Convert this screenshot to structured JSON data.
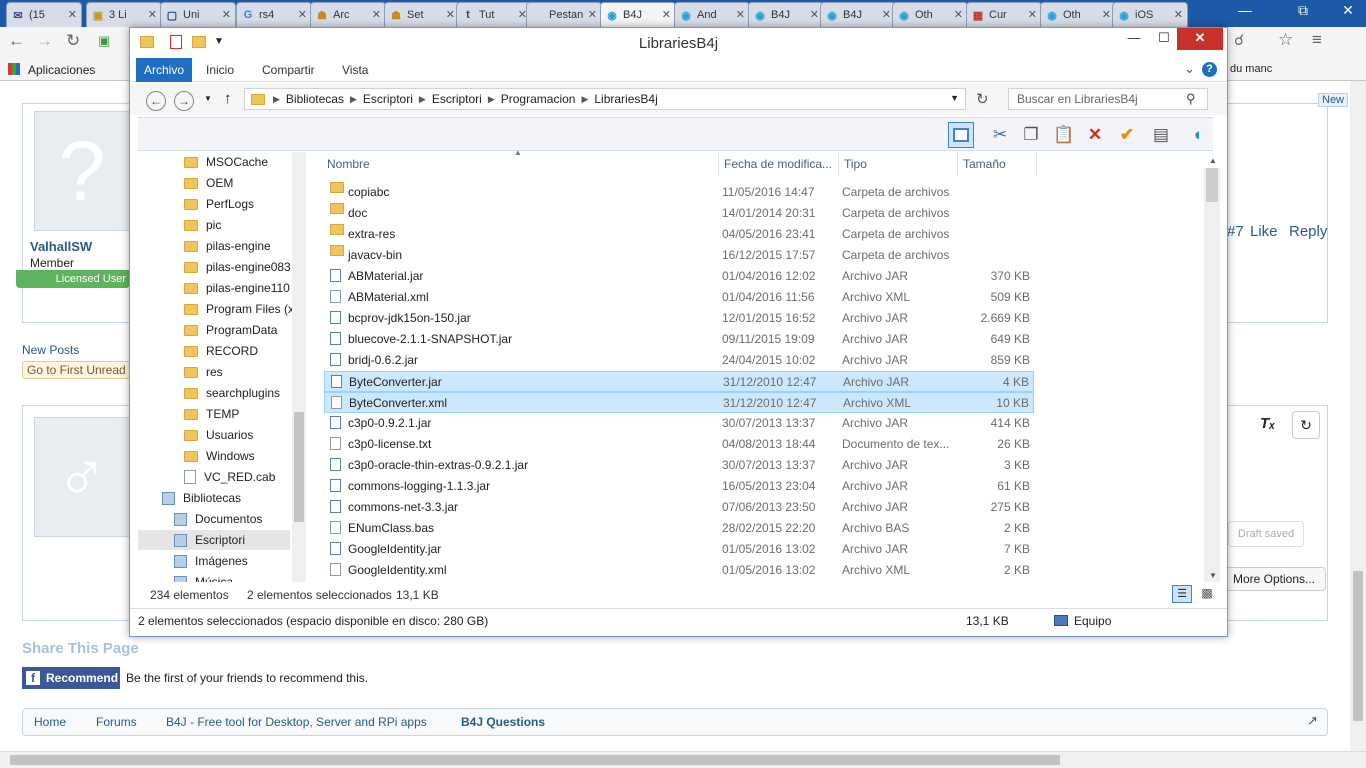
{
  "browser": {
    "tabs": [
      {
        "label": "(15",
        "icon": "mail-icon"
      },
      {
        "label": "3 Li",
        "icon": "shop-icon"
      },
      {
        "label": "Uni",
        "icon": "doc-icon"
      },
      {
        "label": "rs4",
        "icon": "google-icon"
      },
      {
        "label": "Arc",
        "icon": "forum-icon"
      },
      {
        "label": "Set",
        "icon": "forum-icon"
      },
      {
        "label": "Tut",
        "icon": "tumblr-icon"
      },
      {
        "label": "Pestan",
        "icon": "blank-icon"
      },
      {
        "label": "B4J",
        "icon": "b4x-icon",
        "active": true
      },
      {
        "label": "And",
        "icon": "b4x-icon"
      },
      {
        "label": "B4J",
        "icon": "b4x-icon"
      },
      {
        "label": "B4J",
        "icon": "b4x-icon"
      },
      {
        "label": "Oth",
        "icon": "b4x-icon"
      },
      {
        "label": "Cur",
        "icon": "gencat-icon"
      },
      {
        "label": "Oth",
        "icon": "b4x-icon"
      },
      {
        "label": "iOS",
        "icon": "b4x-icon"
      }
    ],
    "bookmarks_label": "Aplicaciones",
    "bookmark_right": "du manc"
  },
  "forum": {
    "user_name": "ValhallSW",
    "user_role": "Member",
    "licensed_label": "Licensed User",
    "new_posts": "New Posts",
    "go_first_unread": "Go to First Unread",
    "post_number": "#7",
    "like": "Like",
    "reply": "Reply",
    "new_badge": "New",
    "draft_saved": "Draft saved",
    "more_options": "More Options...",
    "share_title": "Share This Page",
    "recommend": "Recommend",
    "recommend_text": "Be the first of your friends to recommend this.",
    "breadcrumbs": [
      "Home",
      "Forums",
      "B4J - Free tool for Desktop, Server and RPi apps",
      "B4J Questions"
    ]
  },
  "explorer": {
    "title": "LibrariesB4j",
    "ribbon_tabs": [
      "Archivo",
      "Inicio",
      "Compartir",
      "Vista"
    ],
    "breadcrumb": [
      "Bibliotecas",
      "Escriptori",
      "Escriptori",
      "Programacion",
      "LibrariesB4j"
    ],
    "search_placeholder": "Buscar en LibrariesB4j",
    "columns": {
      "name": "Nombre",
      "date": "Fecha de modifica...",
      "type": "Tipo",
      "size": "Tamaño"
    },
    "nav_items": [
      {
        "label": "MSOCache",
        "kind": "folder"
      },
      {
        "label": "OEM",
        "kind": "folder"
      },
      {
        "label": "PerfLogs",
        "kind": "folder"
      },
      {
        "label": "pic",
        "kind": "folder"
      },
      {
        "label": "pilas-engine",
        "kind": "folder"
      },
      {
        "label": "pilas-engine083",
        "kind": "folder"
      },
      {
        "label": "pilas-engine110",
        "kind": "folder"
      },
      {
        "label": "Program Files (x",
        "kind": "folder"
      },
      {
        "label": "ProgramData",
        "kind": "folder"
      },
      {
        "label": "RECORD",
        "kind": "folder"
      },
      {
        "label": "res",
        "kind": "folder"
      },
      {
        "label": "searchplugins",
        "kind": "folder"
      },
      {
        "label": "TEMP",
        "kind": "folder"
      },
      {
        "label": "Usuarios",
        "kind": "folder"
      },
      {
        "label": "Windows",
        "kind": "folder"
      },
      {
        "label": "VC_RED.cab",
        "kind": "file"
      },
      {
        "label": "Bibliotecas",
        "kind": "library"
      },
      {
        "label": "Documentos",
        "kind": "library"
      },
      {
        "label": "Escriptori",
        "kind": "library"
      },
      {
        "label": "Imágenes",
        "kind": "library"
      },
      {
        "label": "Música",
        "kind": "library"
      }
    ],
    "files": [
      {
        "name": "copiabc",
        "date": "11/05/2016 14:47",
        "type": "Carpeta de archivos",
        "size": "",
        "kind": "folder"
      },
      {
        "name": "doc",
        "date": "14/01/2014 20:31",
        "type": "Carpeta de archivos",
        "size": "",
        "kind": "folder"
      },
      {
        "name": "extra-res",
        "date": "04/05/2016 23:41",
        "type": "Carpeta de archivos",
        "size": "",
        "kind": "folder"
      },
      {
        "name": "javacv-bin",
        "date": "16/12/2015 17:57",
        "type": "Carpeta de archivos",
        "size": "",
        "kind": "folder"
      },
      {
        "name": "ABMaterial.jar",
        "date": "01/04/2016 12:02",
        "type": "Archivo JAR",
        "size": "370 KB",
        "kind": "jar"
      },
      {
        "name": "ABMaterial.xml",
        "date": "01/04/2016 11:56",
        "type": "Archivo XML",
        "size": "509 KB",
        "kind": "xml"
      },
      {
        "name": "bcprov-jdk15on-150.jar",
        "date": "12/01/2015 16:52",
        "type": "Archivo JAR",
        "size": "2.669 KB",
        "kind": "jar"
      },
      {
        "name": "bluecove-2.1.1-SNAPSHOT.jar",
        "date": "09/11/2015 19:09",
        "type": "Archivo JAR",
        "size": "649 KB",
        "kind": "jar"
      },
      {
        "name": "bridj-0.6.2.jar",
        "date": "24/04/2015 10:02",
        "type": "Archivo JAR",
        "size": "859 KB",
        "kind": "jar"
      },
      {
        "name": "ByteConverter.jar",
        "date": "31/12/2010 12:47",
        "type": "Archivo JAR",
        "size": "4 KB",
        "kind": "jar",
        "selected": true
      },
      {
        "name": "ByteConverter.xml",
        "date": "31/12/2010 12:47",
        "type": "Archivo XML",
        "size": "10 KB",
        "kind": "xml",
        "selected": true
      },
      {
        "name": "c3p0-0.9.2.1.jar",
        "date": "30/07/2013 13:37",
        "type": "Archivo JAR",
        "size": "414 KB",
        "kind": "jar"
      },
      {
        "name": "c3p0-license.txt",
        "date": "04/08/2013 18:44",
        "type": "Documento de tex...",
        "size": "26 KB",
        "kind": "txt"
      },
      {
        "name": "c3p0-oracle-thin-extras-0.9.2.1.jar",
        "date": "30/07/2013 13:37",
        "type": "Archivo JAR",
        "size": "3 KB",
        "kind": "jar"
      },
      {
        "name": "commons-logging-1.1.3.jar",
        "date": "16/05/2013 23:04",
        "type": "Archivo JAR",
        "size": "61 KB",
        "kind": "jar"
      },
      {
        "name": "commons-net-3.3.jar",
        "date": "07/06/2013 23:50",
        "type": "Archivo JAR",
        "size": "275 KB",
        "kind": "jar"
      },
      {
        "name": "ENumClass.bas",
        "date": "28/02/2015 22:20",
        "type": "Archivo BAS",
        "size": "2 KB",
        "kind": "txt"
      },
      {
        "name": "GoogleIdentity.jar",
        "date": "01/05/2016 13:02",
        "type": "Archivo JAR",
        "size": "7 KB",
        "kind": "jar"
      },
      {
        "name": "GoogleIdentity.xml",
        "date": "01/05/2016 13:02",
        "type": "Archivo XML",
        "size": "2 KB",
        "kind": "xml"
      }
    ],
    "status": {
      "count": "234 elementos",
      "selected": "2 elementos seleccionados",
      "selected_size": "13,1 KB",
      "details": "2 elementos seleccionados (espacio disponible en disco: 280 GB)",
      "details_size": "13,1 KB",
      "computer": "Equipo"
    }
  }
}
